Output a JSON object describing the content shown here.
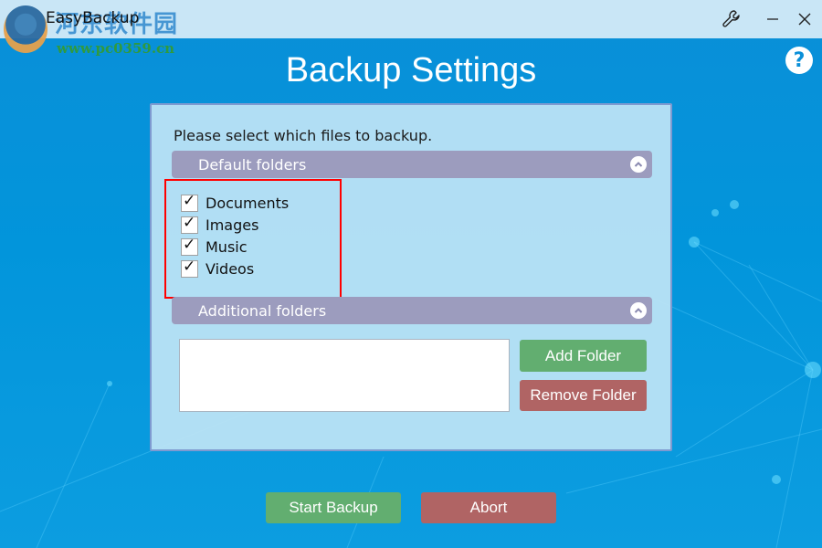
{
  "window": {
    "title": "EasyBackup",
    "watermark_text": "河东软件园",
    "watermark_url": "www.pc0359.cn",
    "controls": {
      "settings_icon": "wrench-icon",
      "minimize_icon": "minimize-icon",
      "close_icon": "close-icon",
      "help_label": "?"
    }
  },
  "page": {
    "title": "Backup Settings"
  },
  "panel": {
    "instructions": "Please select which files to backup.",
    "default_folders": {
      "header": "Default folders",
      "items": [
        {
          "label": "Documents",
          "checked": true
        },
        {
          "label": "Images",
          "checked": true
        },
        {
          "label": "Music",
          "checked": true
        },
        {
          "label": "Videos",
          "checked": true
        }
      ]
    },
    "additional_folders": {
      "header": "Additional folders",
      "list_items": [],
      "add_button": "Add Folder",
      "remove_button": "Remove Folder"
    }
  },
  "footer": {
    "start_button": "Start Backup",
    "abort_button": "Abort"
  },
  "colors": {
    "background": "#0295db",
    "titlebar": "#c9e6f6",
    "panel": "#bee4f5",
    "section_header": "#9c9cbe",
    "green_button": "#62ae70",
    "red_button": "#b06464",
    "highlight": "#ff0000"
  }
}
